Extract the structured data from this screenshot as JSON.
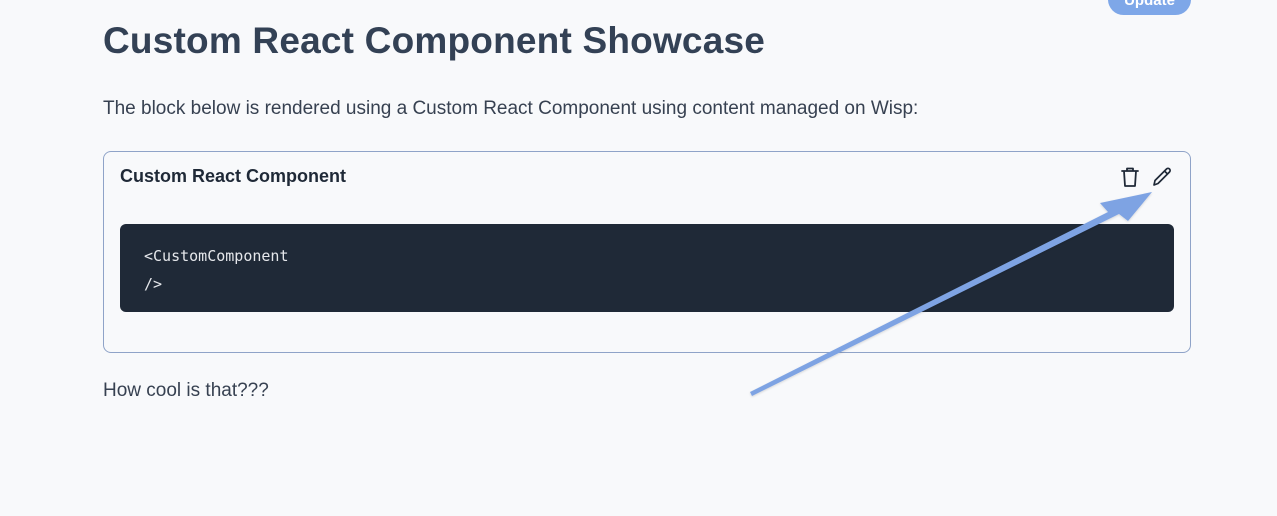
{
  "header": {
    "update_label": "Update"
  },
  "page": {
    "title": "Custom React Component Showcase",
    "intro": "The block below is rendered using a Custom React Component using content managed on Wisp:",
    "outro": "How cool is that???"
  },
  "component_block": {
    "title": "Custom React Component",
    "actions": {
      "delete_icon": "trash-icon",
      "edit_icon": "pencil-icon"
    },
    "code_lines": [
      "<CustomComponent",
      "/>"
    ]
  },
  "colors": {
    "accent": "#7ea7e8",
    "code_bg": "#1f2937",
    "card_border": "#8fa3c8",
    "arrow": "#7ea3e3"
  }
}
